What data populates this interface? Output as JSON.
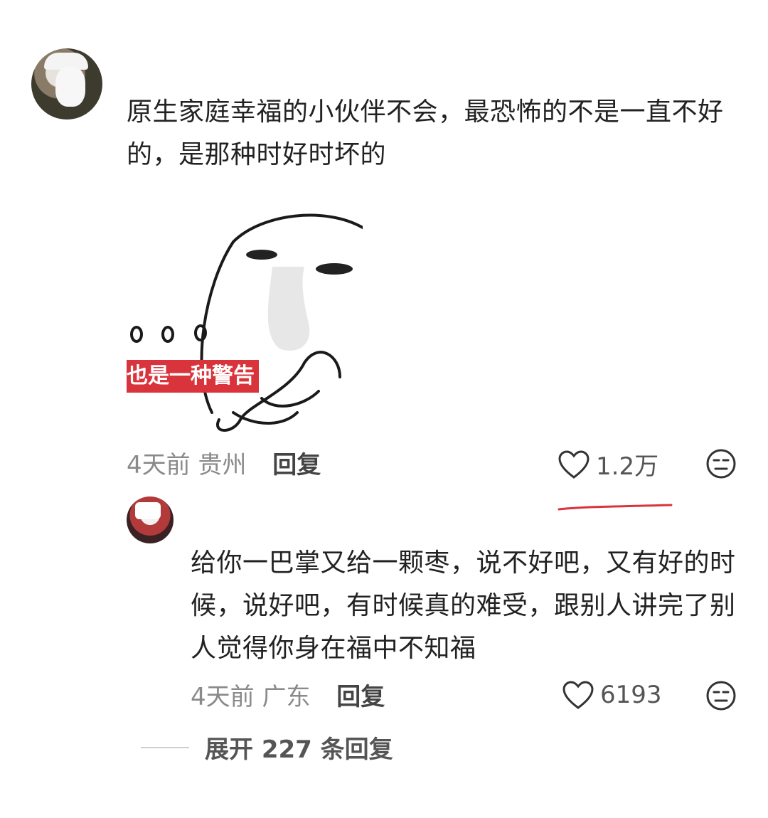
{
  "comment": {
    "text": "原生家庭幸福的小伙伴不会，最恐怖的不是一直不好的，是那种时好时坏的",
    "sticker_caption": "也是一种警告",
    "time": "4天前",
    "location": "贵州",
    "reply_label": "回复",
    "like_count": "1.2万"
  },
  "reply": {
    "text": "给你一巴掌又给一颗枣，说不好吧，又有好的时候，说好吧，有时候真的难受，跟别人讲完了别人觉得你身在福中不知福",
    "time": "4天前",
    "location": "广东",
    "reply_label": "回复",
    "like_count": "6193"
  },
  "expand": {
    "label": "展开 227 条回复"
  },
  "colors": {
    "caption_bg": "#d9333c",
    "underline": "#d9333c"
  }
}
